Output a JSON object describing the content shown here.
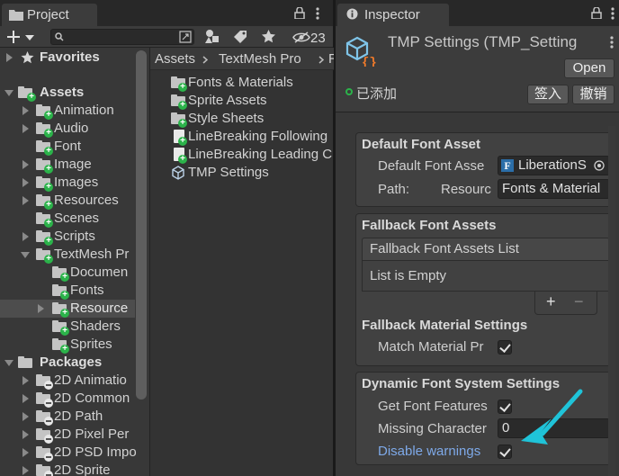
{
  "project": {
    "tab_title": "Project",
    "search": {
      "value": "",
      "placeholder": ""
    },
    "hidden_count": "23",
    "favorites_label": "Favorites",
    "assets_label": "Assets",
    "asset_folders": [
      "Animation",
      "Audio",
      "Font",
      "Image",
      "Images",
      "Resources",
      "Scenes",
      "Scripts",
      "TextMesh Pr"
    ],
    "textmesh_children": [
      "Documen",
      "Fonts",
      "Resource",
      "Shaders",
      "Sprites"
    ],
    "packages_label": "Packages",
    "packages": [
      "2D Animatio",
      "2D Common",
      "2D Path",
      "2D Pixel Per",
      "2D PSD Impo",
      "2D Sprite"
    ],
    "breadcrumb": [
      "Assets",
      "TextMesh Pro",
      "R"
    ],
    "files": [
      "Fonts & Materials",
      "Sprite Assets",
      "Style Sheets",
      "LineBreaking Following",
      "LineBreaking Leading C",
      "TMP Settings"
    ]
  },
  "inspector": {
    "tab_title": "Inspector",
    "object_title": "TMP Settings (TMP_Setting",
    "open_button": "Open",
    "added_status": "已添加",
    "checkin_button": "签入",
    "revert_button": "撤销",
    "default_font": {
      "title": "Default Font Asset",
      "asset_label": "Default Font Asse",
      "asset_value": "LiberationS",
      "path_label": "Path:",
      "path_sublabel": "Resourc",
      "path_value": "Fonts & Material"
    },
    "fallback": {
      "title": "Fallback Font Assets",
      "list_header": "Fallback Font Assets List",
      "list_empty": "List is Empty",
      "add_symbol": "+",
      "remove_symbol": "−"
    },
    "fallback_material": {
      "title": "Fallback Material Settings",
      "match_label": "Match Material Pr",
      "match_checked": true
    },
    "dynamic": {
      "title": "Dynamic Font System Settings",
      "features_label": "Get Font Features",
      "features_checked": true,
      "missing_label": "Missing Character",
      "missing_value": "0",
      "warnings_label": "Disable warnings",
      "warnings_checked": true
    }
  },
  "colors": {
    "accent_link": "#7ea9e8",
    "annotation_arrow": "#1fc3d8",
    "added_badge": "#2bb34a"
  }
}
